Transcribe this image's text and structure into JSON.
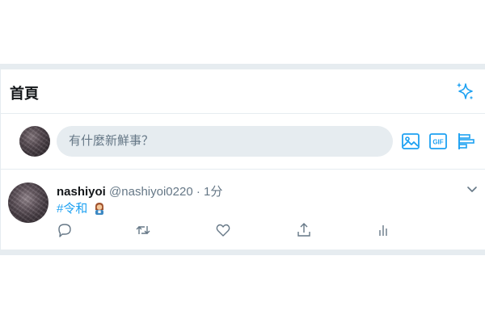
{
  "header": {
    "title": "首頁"
  },
  "compose": {
    "placeholder": "有什麼新鮮事？"
  },
  "tweet": {
    "display_name": "nashiyoi",
    "handle": "@nashiyoi0220",
    "separator": "·",
    "time": "1分",
    "hashtag": "#令和"
  },
  "icons": {
    "sparkle": "sparkle-icon",
    "image": "image-icon",
    "gif": "gif-icon",
    "poll": "poll-icon",
    "chevron": "chevron-down-icon",
    "reply": "reply-icon",
    "retweet": "retweet-icon",
    "like": "like-icon",
    "share": "share-icon",
    "analytics": "analytics-icon"
  },
  "colors": {
    "accent": "#1da1f2",
    "divider": "#e6ecf0",
    "muted": "#657786",
    "text": "#14171a"
  }
}
